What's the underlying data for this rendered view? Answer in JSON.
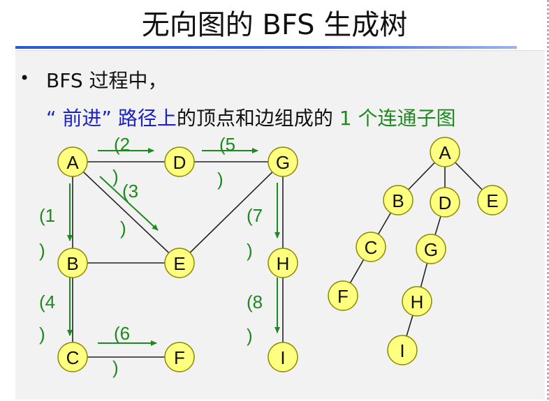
{
  "title": "无向图的 BFS 生成树",
  "bullet": {
    "line1": "BFS 过程中，",
    "line2_part1": "“ 前进” 路径上",
    "line2_part2": "的顶点和边组成的",
    "line2_part3": " 1 个连通子图"
  },
  "colors": {
    "accent_blue": "#1a22c8",
    "accent_green": "#1c8a1c",
    "node_fill": "#ffff80"
  },
  "graph": {
    "nodes": [
      {
        "id": "A",
        "label": "A"
      },
      {
        "id": "D",
        "label": "D"
      },
      {
        "id": "G",
        "label": "G"
      },
      {
        "id": "B",
        "label": "B"
      },
      {
        "id": "E",
        "label": "E"
      },
      {
        "id": "H",
        "label": "H"
      },
      {
        "id": "C",
        "label": "C"
      },
      {
        "id": "F",
        "label": "F"
      },
      {
        "id": "I",
        "label": "I"
      }
    ],
    "edges": [
      [
        "A",
        "D"
      ],
      [
        "D",
        "G"
      ],
      [
        "A",
        "B"
      ],
      [
        "A",
        "E"
      ],
      [
        "B",
        "E"
      ],
      [
        "E",
        "G"
      ],
      [
        "G",
        "H"
      ],
      [
        "B",
        "C"
      ],
      [
        "C",
        "F"
      ],
      [
        "H",
        "I"
      ]
    ],
    "steps": [
      {
        "from": "A",
        "to": "B",
        "label": "(1",
        "close": ")"
      },
      {
        "from": "A",
        "to": "D",
        "label": "(2",
        "close": ")"
      },
      {
        "from": "A",
        "to": "E",
        "label": "(3",
        "close": ")"
      },
      {
        "from": "B",
        "to": "C",
        "label": "(4",
        "close": ")"
      },
      {
        "from": "D",
        "to": "G",
        "label": "(5",
        "close": ")"
      },
      {
        "from": "C",
        "to": "F",
        "label": "(6",
        "close": ")"
      },
      {
        "from": "G",
        "to": "H",
        "label": "(7",
        "close": ")"
      },
      {
        "from": "H",
        "to": "I",
        "label": "(8",
        "close": ")"
      }
    ]
  },
  "tree": {
    "nodes": [
      {
        "id": "A",
        "label": "A"
      },
      {
        "id": "B",
        "label": "B"
      },
      {
        "id": "D",
        "label": "D"
      },
      {
        "id": "E",
        "label": "E"
      },
      {
        "id": "C",
        "label": "C"
      },
      {
        "id": "G",
        "label": "G"
      },
      {
        "id": "F",
        "label": "F"
      },
      {
        "id": "H",
        "label": "H"
      },
      {
        "id": "I",
        "label": "I"
      }
    ],
    "edges": [
      [
        "A",
        "B"
      ],
      [
        "A",
        "D"
      ],
      [
        "A",
        "E"
      ],
      [
        "B",
        "C"
      ],
      [
        "D",
        "G"
      ],
      [
        "C",
        "F"
      ],
      [
        "G",
        "H"
      ],
      [
        "H",
        "I"
      ]
    ]
  }
}
